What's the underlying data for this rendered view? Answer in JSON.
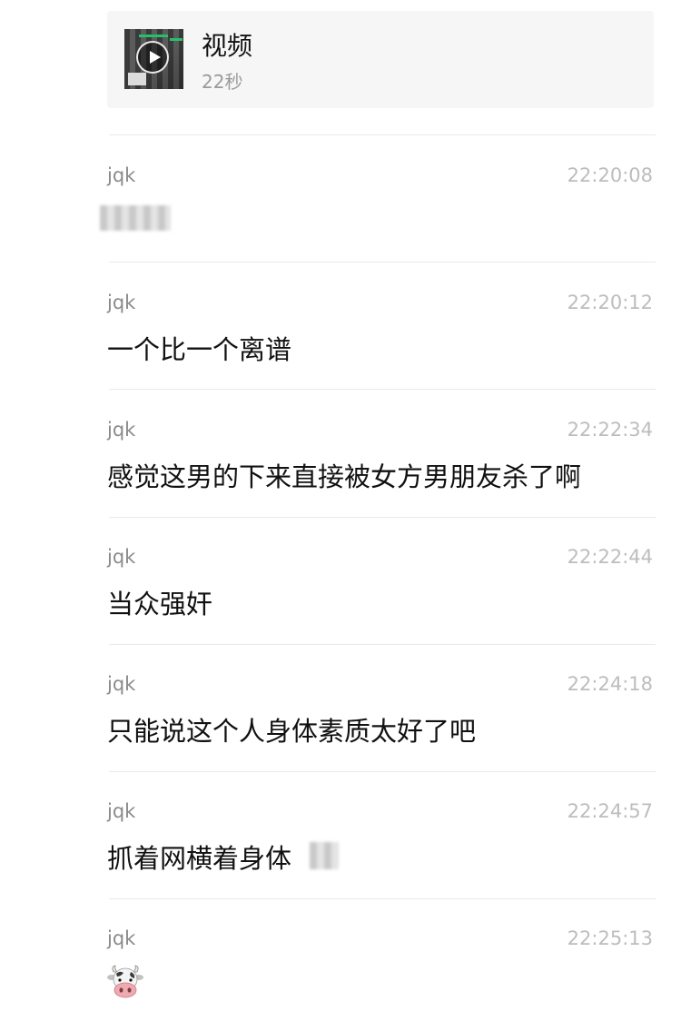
{
  "video": {
    "title": "视频",
    "duration": "22秒",
    "icon": "play-icon"
  },
  "messages": [
    {
      "sender": "jqk",
      "time": "22:20:08",
      "text": "",
      "content_type": "redacted"
    },
    {
      "sender": "jqk",
      "time": "22:20:12",
      "text": "一个比一个离谱"
    },
    {
      "sender": "jqk",
      "time": "22:22:34",
      "text": "感觉这男的下来直接被女方男朋友杀了啊"
    },
    {
      "sender": "jqk",
      "time": "22:22:44",
      "text": "当众强奸"
    },
    {
      "sender": "jqk",
      "time": "22:24:18",
      "text": "只能说这个人身体素质太好了吧"
    },
    {
      "sender": "jqk",
      "time": "22:24:57",
      "text": "抓着网横着身体"
    },
    {
      "sender": "jqk",
      "time": "22:25:13",
      "text": "",
      "content_type": "emoji",
      "icon": "cow-face-emoji"
    }
  ]
}
